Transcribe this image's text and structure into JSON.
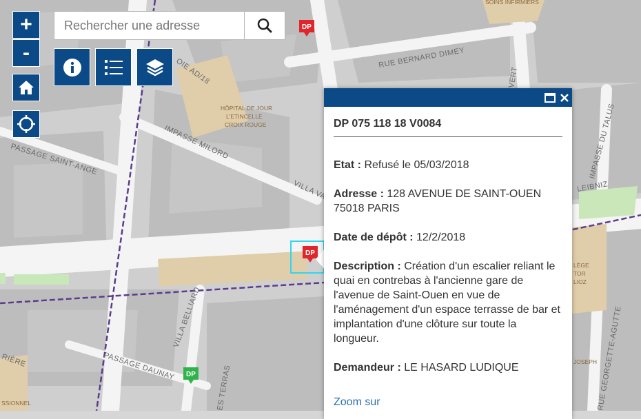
{
  "search": {
    "placeholder": "Rechercher une adresse"
  },
  "controls": {
    "zoom_in_label": "+",
    "zoom_out_label": "-"
  },
  "markers": [
    {
      "label": "DP",
      "color": "#e0262b"
    },
    {
      "label": "DP",
      "color": "#e0262b"
    },
    {
      "label": "DP",
      "color": "#2fb34a"
    }
  ],
  "map_labels": {
    "rue_bernard_dimey": "RUE BERNARD DIMEY",
    "passage_saint_ange": "PASSAGE SAINT-ANGE",
    "impasse_milord": "IMPASSE MILORD",
    "villa_va": "VILLA VA",
    "passage_daunay": "PASSAGE DAUNAY",
    "villa_belliard": "VILLA BELLIARD",
    "impasse_du_talus": "IMPASSE DU TALUS",
    "leibniz": "LEIBNIZ",
    "rue_george_agutte": "RUE GEORGETTE-AGUTTE",
    "rue_ad18": "OIE AD/18",
    "hopital": [
      "HÔPITAL DE JOUR",
      "L'ETINCELLE",
      "CROIX ROUGE"
    ],
    "soins_infirmiers": "SOINS INFIRMIERS",
    "vert": "VERT",
    "les_terrasses": "ES TERRAS",
    "riere": "RIÈRE",
    "ssionnel": "SSIONNEL",
    "lege": "LÈGE",
    "tor": "TOR",
    "lioz": "LIOZ",
    "joseph": "JOSEPH"
  },
  "popup": {
    "title": "DP 075 118 18 V0084",
    "etat_label": "Etat :",
    "etat_value": "Refusé le 05/03/2018",
    "adresse_label": "Adresse :",
    "adresse_value": "128 AVENUE DE SAINT-OUEN 75018 PARIS",
    "date_label": "Date de dépôt :",
    "date_value": "12/2/2018",
    "description_label": "Description :",
    "description_value": "Création d'un escalier reliant le quai en contrebas à l'ancienne gare de l'avenue de Saint-Ouen en vue de l'aménagement d'un espace terrasse de bar et implantation d'une clôture sur toute la longueur.",
    "demandeur_label": "Demandeur :",
    "demandeur_value": "LE HASARD LUDIQUE",
    "zoom_link": "Zoom sur"
  },
  "colors": {
    "brand": "#0b4a86",
    "highlight": "#30d5f0",
    "boundary": "#5b3c8c",
    "park": "#c9e7b9",
    "poi_area": "#e0cda9"
  }
}
